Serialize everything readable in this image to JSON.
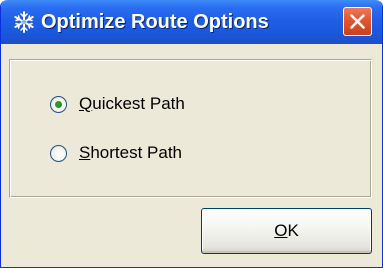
{
  "window": {
    "title": "Optimize Route Options",
    "title_icon": "snowflake-icon",
    "close_icon": "close-icon"
  },
  "options": [
    {
      "mnemonic": "Q",
      "rest": "uickest Path",
      "selected": true
    },
    {
      "mnemonic": "S",
      "rest": "hortest Path",
      "selected": false
    }
  ],
  "buttons": {
    "ok": {
      "mnemonic": "O",
      "rest": "K"
    }
  },
  "colors": {
    "title_bar": "#1f5fe6",
    "close_button": "#e2552f",
    "dialog_background": "#ece9d8",
    "radio_selected_dot": "#21a121"
  }
}
